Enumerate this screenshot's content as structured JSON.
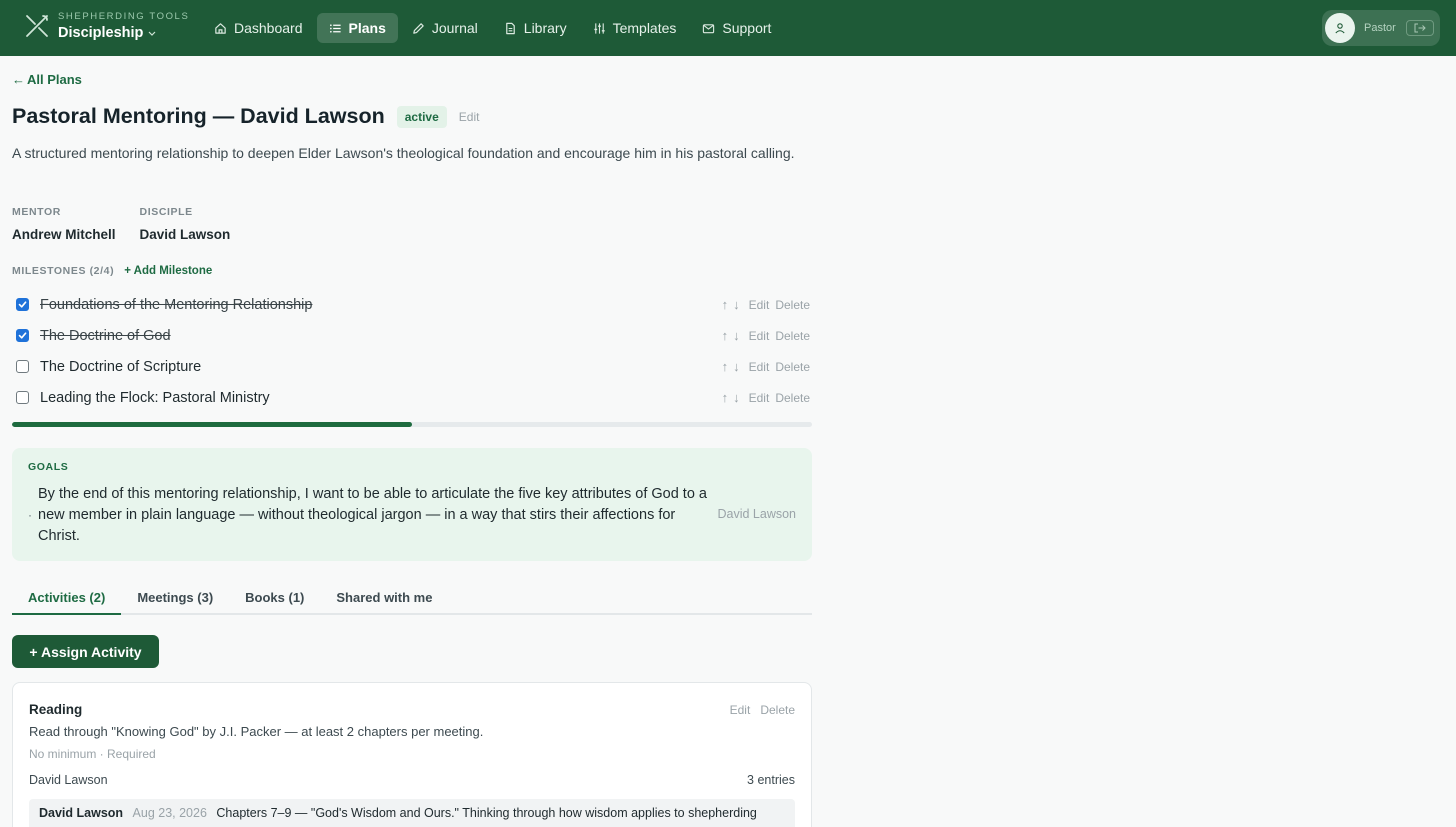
{
  "brand": {
    "subtitle": "SHEPHERDING TOOLS",
    "name": "Discipleship",
    "logo_icon": "crossed-staff-icon"
  },
  "nav": [
    {
      "label": "Dashboard",
      "icon": "home-icon",
      "active": false
    },
    {
      "label": "Plans",
      "icon": "list-icon",
      "active": true
    },
    {
      "label": "Journal",
      "icon": "pencil-icon",
      "active": false
    },
    {
      "label": "Library",
      "icon": "document-icon",
      "active": false
    },
    {
      "label": "Templates",
      "icon": "sliders-icon",
      "active": false
    },
    {
      "label": "Support",
      "icon": "mail-icon",
      "active": false
    }
  ],
  "user": {
    "name": "Pastor",
    "avatar_icon": "user-icon",
    "logout_icon": "logout-icon"
  },
  "back_link": {
    "arrow": "←",
    "label": "All Plans"
  },
  "plan": {
    "title": "Pastoral Mentoring — David Lawson",
    "status": "active",
    "edit_label": "Edit",
    "description": "A structured mentoring relationship to deepen Elder Lawson's theological foundation and encourage him in his pastoral calling."
  },
  "people": {
    "mentor_label": "MENTOR",
    "mentor": "Andrew Mitchell",
    "disciple_label": "DISCIPLE",
    "disciple": "David Lawson"
  },
  "milestones": {
    "label": "MILESTONES (2/4)",
    "add_label": "+ Add Milestone",
    "progress_fraction": 0.5,
    "up_arrow": "↑",
    "down_arrow": "↓",
    "edit_label": "Edit",
    "delete_label": "Delete",
    "items": [
      {
        "title": "Foundations of the Mentoring Relationship",
        "done": true
      },
      {
        "title": "The Doctrine of God",
        "done": true
      },
      {
        "title": "The Doctrine of Scripture",
        "done": false
      },
      {
        "title": "Leading the Flock: Pastoral Ministry",
        "done": false
      }
    ]
  },
  "goals": {
    "label": "GOALS",
    "bullet": "·",
    "text": "By the end of this mentoring relationship, I want to be able to articulate the five key attributes of God to a new member in plain language — without theological jargon — in a way that stirs their affections for Christ.",
    "author": "David Lawson"
  },
  "tabs": [
    {
      "label": "Activities (2)",
      "active": true
    },
    {
      "label": "Meetings (3)",
      "active": false
    },
    {
      "label": "Books (1)",
      "active": false
    },
    {
      "label": "Shared with me",
      "active": false
    }
  ],
  "assign_button": "+ Assign Activity",
  "activity": {
    "title": "Reading",
    "edit_label": "Edit",
    "delete_label": "Delete",
    "description": "Read through \"Knowing God\" by J.I. Packer — at least 2 chapters per meeting.",
    "meta": "No minimum · Required",
    "assignee": "David Lawson",
    "entries_count": "3 entries",
    "entry": {
      "author": "David Lawson",
      "date": "Aug 23, 2026",
      "text": "Chapters 7–9 — \"God's Wisdom and Ours.\" Thinking through how wisdom applies to shepherding"
    }
  },
  "colors": {
    "brand_green": "#1e5a37",
    "accent_green": "#1e6b43",
    "goals_bg": "#e8f5ed",
    "checkbox_blue": "#1f72d9"
  }
}
